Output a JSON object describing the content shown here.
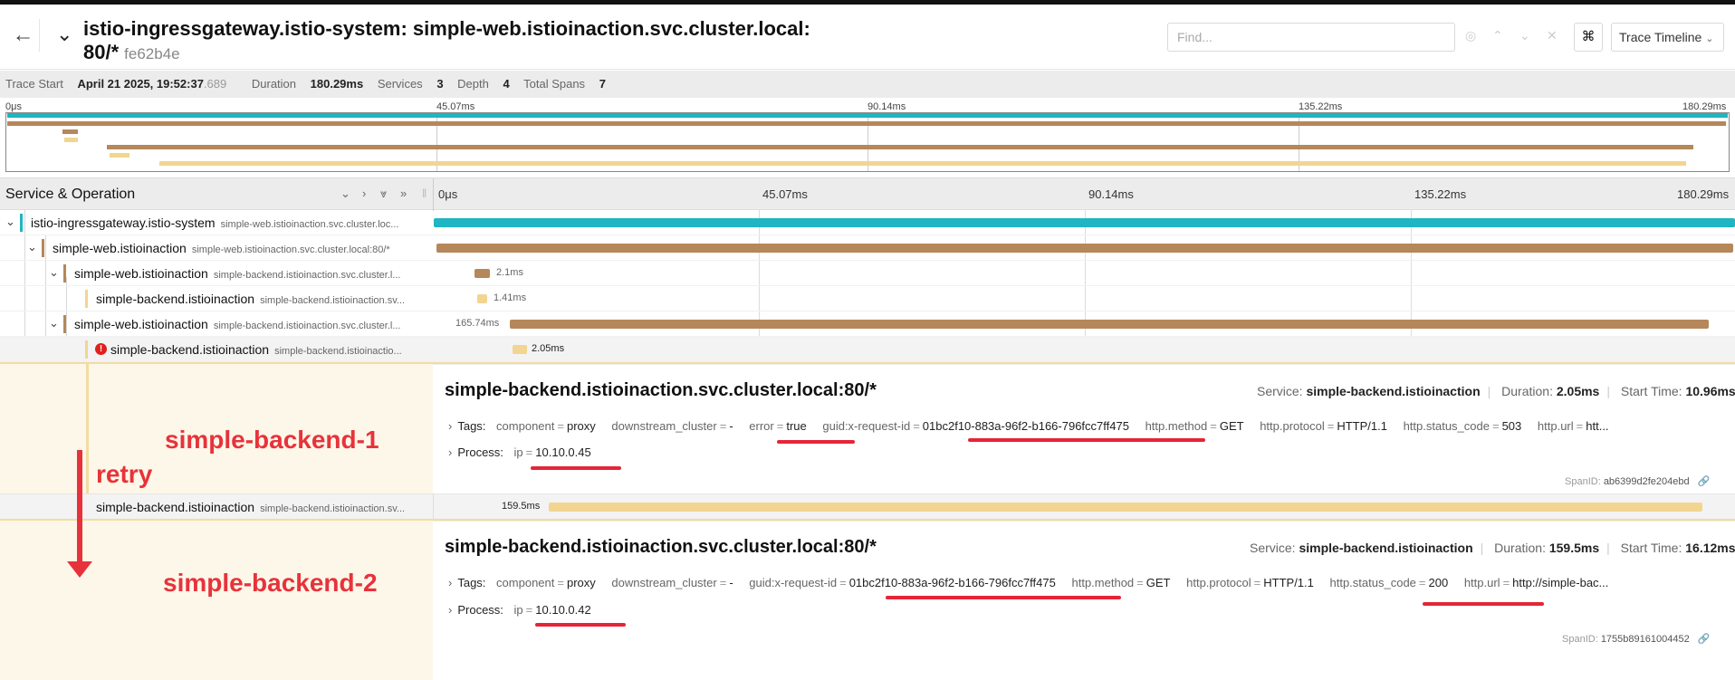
{
  "header": {
    "back_icon": "arrow-left-icon",
    "title": "istio-ingressgateway.istio-system: simple-web.istioinaction.svc.cluster.local:",
    "title_cont": "80/*",
    "trace_id": "fe62b4e",
    "find_placeholder": "Find...",
    "keyboard_icon": "⌘",
    "view_label": "Trace Timeline"
  },
  "summary": {
    "trace_start_label": "Trace Start",
    "trace_start": "April 21 2025, 19:52:37",
    "trace_start_ms": ".689",
    "duration_label": "Duration",
    "duration": "180.29ms",
    "services_label": "Services",
    "services": "3",
    "depth_label": "Depth",
    "depth": "4",
    "spans_label": "Total Spans",
    "spans": "7"
  },
  "ticks": [
    "0μs",
    "45.07ms",
    "90.14ms",
    "135.22ms",
    "180.29ms"
  ],
  "colors": {
    "ingress": "#1fb5c2",
    "web": "#b5875a",
    "backend": "#f2d590",
    "error": "#e0201b"
  },
  "columns": {
    "service_label": "Service & Operation"
  },
  "spans": [
    {
      "service": "istio-ingressgateway.istio-system",
      "op": "simple-web.istioinaction.svc.cluster.loc...",
      "duration": ""
    },
    {
      "service": "simple-web.istioinaction",
      "op": "simple-web.istioinaction.svc.cluster.local:80/*",
      "duration": ""
    },
    {
      "service": "simple-web.istioinaction",
      "op": "simple-backend.istioinaction.svc.cluster.l...",
      "duration": "2.1ms"
    },
    {
      "service": "simple-backend.istioinaction",
      "op": "simple-backend.istioinaction.sv...",
      "duration": "1.41ms"
    },
    {
      "service": "simple-web.istioinaction",
      "op": "simple-backend.istioinaction.svc.cluster.l...",
      "duration": "165.74ms"
    },
    {
      "service": "simple-backend.istioinaction",
      "op": "simple-backend.istioinactio...",
      "duration": "2.05ms"
    },
    {
      "service": "simple-backend.istioinaction",
      "op": "simple-backend.istioinaction.sv...",
      "duration": "159.5ms"
    }
  ],
  "detail1": {
    "title": "simple-backend.istioinaction.svc.cluster.local:80/*",
    "service_label": "Service:",
    "service": "simple-backend.istioinaction",
    "duration_label": "Duration:",
    "duration": "2.05ms",
    "start_label": "Start Time:",
    "start": "10.96ms",
    "tags_label": "Tags:",
    "tags": [
      [
        "component",
        "proxy"
      ],
      [
        "downstream_cluster",
        "-"
      ],
      [
        "error",
        "true"
      ],
      [
        "guid:x-request-id",
        "01bc2f10-883a-96f2-b166-796fcc7ff475"
      ],
      [
        "http.method",
        "GET"
      ],
      [
        "http.protocol",
        "HTTP/1.1"
      ],
      [
        "http.status_code",
        "503"
      ],
      [
        "http.url",
        "htt..."
      ]
    ],
    "process_label": "Process:",
    "process": [
      [
        "ip",
        "10.10.0.45"
      ]
    ],
    "spanid_label": "SpanID:",
    "spanid": "ab6399d2fe204ebd"
  },
  "detail2": {
    "title": "simple-backend.istioinaction.svc.cluster.local:80/*",
    "service_label": "Service:",
    "service": "simple-backend.istioinaction",
    "duration_label": "Duration:",
    "duration": "159.5ms",
    "start_label": "Start Time:",
    "start": "16.12ms",
    "tags_label": "Tags:",
    "tags": [
      [
        "component",
        "proxy"
      ],
      [
        "downstream_cluster",
        "-"
      ],
      [
        "guid:x-request-id",
        "01bc2f10-883a-96f2-b166-796fcc7ff475"
      ],
      [
        "http.method",
        "GET"
      ],
      [
        "http.protocol",
        "HTTP/1.1"
      ],
      [
        "http.status_code",
        "200"
      ],
      [
        "http.url",
        "http://simple-bac..."
      ]
    ],
    "process_label": "Process:",
    "process": [
      [
        "ip",
        "10.10.0.42"
      ]
    ],
    "spanid_label": "SpanID:",
    "spanid": "1755b89161004452"
  },
  "annotations": {
    "backend1": "simple-backend-1",
    "retry": "retry",
    "backend2": "simple-backend-2"
  }
}
